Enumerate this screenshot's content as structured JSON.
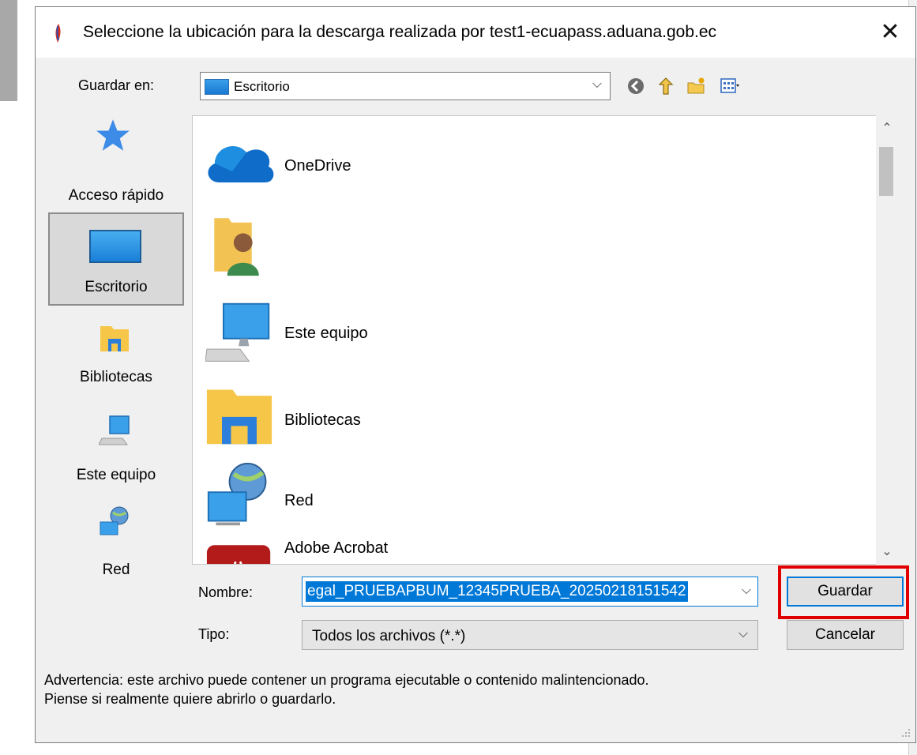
{
  "dialog": {
    "title": "Seleccione la ubicación para la descarga realizada por test1-ecuapass.aduana.gob.ec",
    "close_glyph": "✕",
    "save_in_label": "Guardar en:",
    "save_in_value": "Escritorio"
  },
  "places": [
    {
      "label": "Acceso rápido",
      "icon": "star-icon"
    },
    {
      "label": "Escritorio",
      "icon": "desktop-icon",
      "selected": true
    },
    {
      "label": "Bibliotecas",
      "icon": "libraries-icon"
    },
    {
      "label": "Este equipo",
      "icon": "computer-icon"
    },
    {
      "label": "Red",
      "icon": "network-icon"
    }
  ],
  "files": [
    {
      "name": "OneDrive",
      "icon": "onedrive-icon"
    },
    {
      "name": "",
      "icon": "user-folder-icon"
    },
    {
      "name": "Este equipo",
      "icon": "computer-icon"
    },
    {
      "name": "Bibliotecas",
      "icon": "libraries-icon"
    },
    {
      "name": "Red",
      "icon": "network-icon"
    },
    {
      "name": "Adobe Acrobat",
      "icon": "acrobat-icon"
    }
  ],
  "form": {
    "name_label": "Nombre:",
    "name_value": "egal_PRUEBAPBUM_12345PRUEBA_20250218151542",
    "type_label": "Tipo:",
    "type_value": "Todos los archivos (*.*)"
  },
  "buttons": {
    "save": "Guardar",
    "cancel": "Cancelar"
  },
  "warning": {
    "line1": "Advertencia: este archivo puede contener un programa ejecutable o contenido malintencionado.",
    "line2": "Piense si realmente quiere abrirlo o guardarlo."
  },
  "colors": {
    "accent": "#0078d7",
    "highlight": "#e00000"
  }
}
